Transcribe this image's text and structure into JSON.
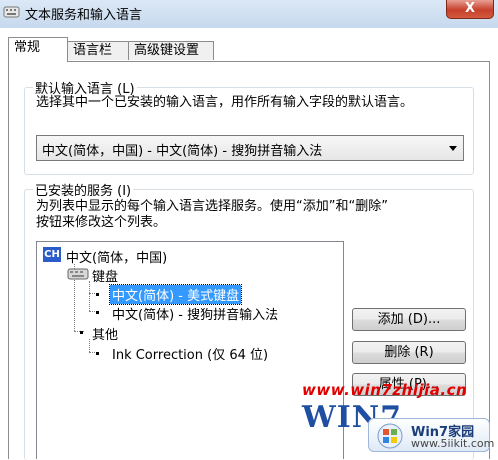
{
  "window": {
    "title": "文本服务和输入语言",
    "close": "X"
  },
  "tabs": [
    {
      "label": "常规",
      "active": true
    },
    {
      "label": "语言栏",
      "active": false
    },
    {
      "label": "高级键设置",
      "active": false
    }
  ],
  "default_language": {
    "group_title": "默认输入语言 (L)",
    "description": "选择其中一个已安装的输入语言，用作所有输入字段的默认语言。",
    "selected": "中文(简体，中国) - 中文(简体) - 搜狗拼音输入法"
  },
  "installed_services": {
    "group_title": "已安装的服务 (I)",
    "description_line1": "为列表中显示的每个输入语言选择服务。使用“添加”和“删除”",
    "description_line2": "按钮来修改这个列表。",
    "tree": {
      "language_badge": "CH",
      "language": "中文(简体，中国)",
      "keyboard_label": "键盘",
      "keyboard_items": [
        "中文(简体) - 美式键盘",
        "中文(简体) - 搜狗拼音输入法"
      ],
      "other_label": "其他",
      "other_items": [
        "Ink Correction (仅 64 位)"
      ]
    },
    "buttons": {
      "add": "添加 (D)...",
      "remove": "删除 (R)",
      "properties": "属性 (P)..."
    }
  },
  "watermark": {
    "url": "www.win7zhijia.cn",
    "logo": "WIN7",
    "badge_title": "Win7家园",
    "badge_url": "www.5iikit.com"
  },
  "colors": {
    "selection": "#3399ff",
    "badge": "#2b5ccc",
    "watermark_red": "#e00000"
  }
}
